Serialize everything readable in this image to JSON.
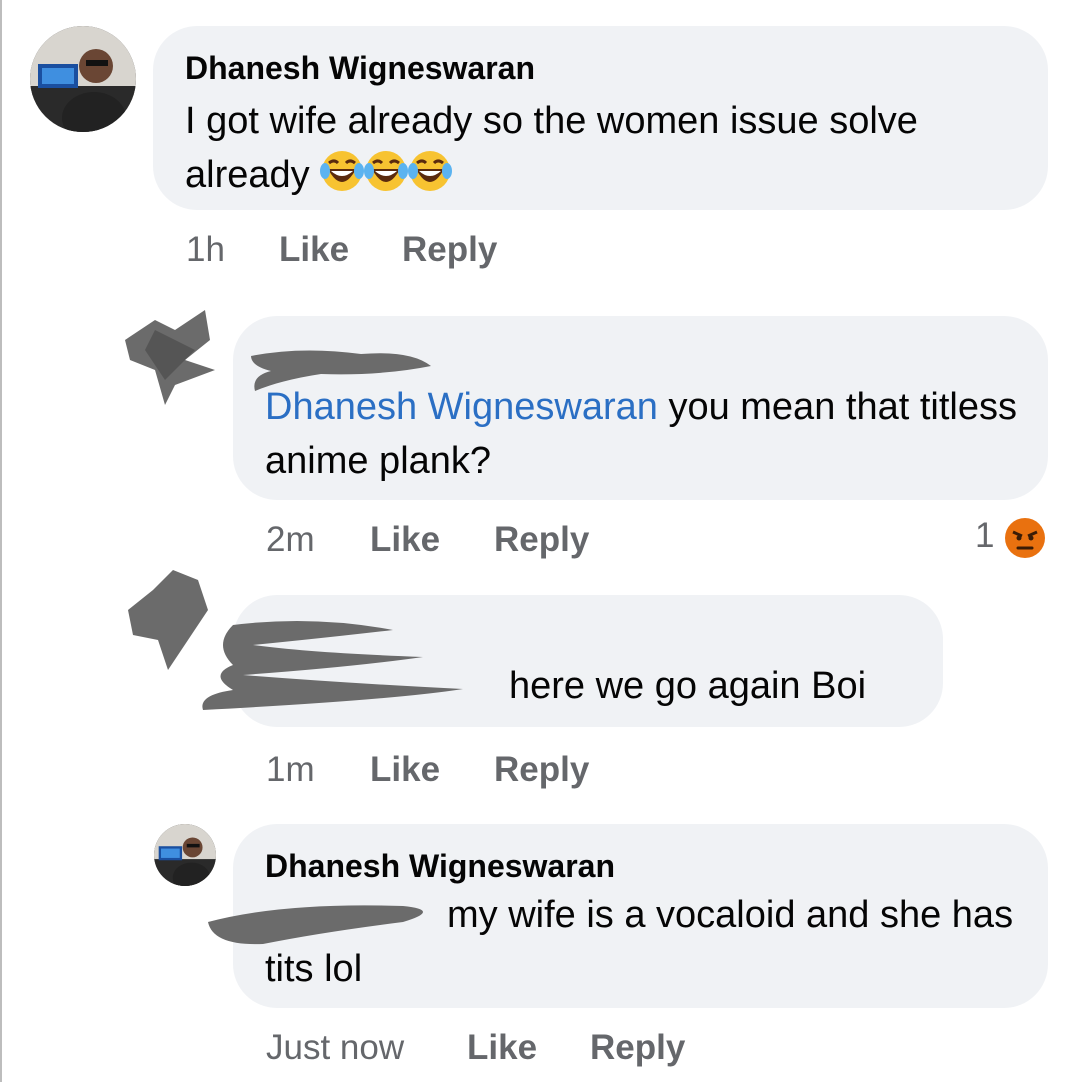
{
  "comments": [
    {
      "author": "Dhanesh Wigneswaran",
      "text": "I got wife already so the women issue solve already",
      "emojis": [
        "face-with-tears-of-joy-icon",
        "face-with-tears-of-joy-icon",
        "face-with-tears-of-joy-icon"
      ],
      "time": "1h",
      "like": "Like",
      "reply": "Reply"
    },
    {
      "author": "",
      "mention": "Dhanesh Wigneswaran",
      "text": " you mean that titless anime plank?",
      "time": "2m",
      "like": "Like",
      "reply": "Reply",
      "reaction_count": "1",
      "reaction_icon": "angry-face-icon"
    },
    {
      "author": "",
      "text": "here we go again Boi",
      "time": "1m",
      "like": "Like",
      "reply": "Reply"
    },
    {
      "author": "Dhanesh Wigneswaran",
      "text": "my wife is a vocaloid and she has tits lol",
      "time": "Just now",
      "like": "Like",
      "reply": "Reply"
    }
  ],
  "colors": {
    "bubble": "#f0f2f5",
    "mention": "#2b6fc4",
    "meta": "#65676b",
    "redaction": "#6b6b6b"
  }
}
